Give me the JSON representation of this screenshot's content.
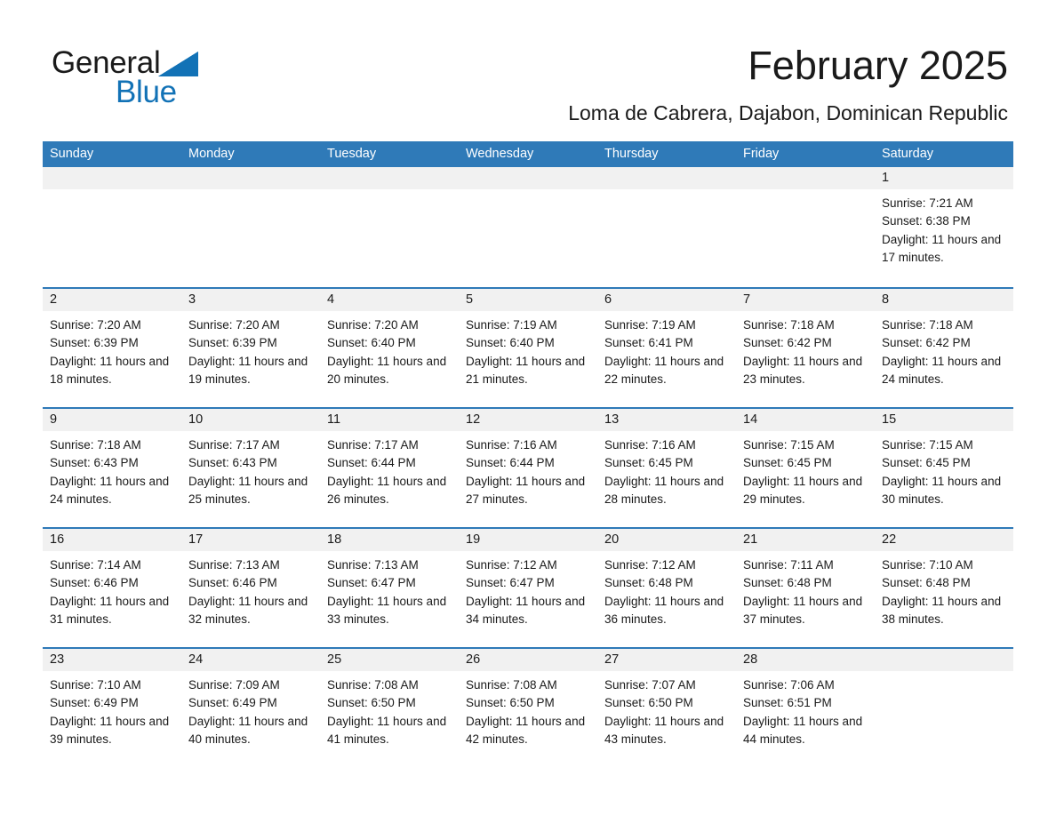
{
  "brand": {
    "word1": "General",
    "word2": "Blue",
    "triangle_color": "#1272b6"
  },
  "header": {
    "month_title": "February 2025",
    "location": "Loma de Cabrera, Dajabon, Dominican Republic",
    "header_bg_color": "#2f7ab8",
    "row_border_color": "#2f7ab8",
    "daynum_band_color": "#f1f1f1"
  },
  "weekdays": [
    "Sunday",
    "Monday",
    "Tuesday",
    "Wednesday",
    "Thursday",
    "Friday",
    "Saturday"
  ],
  "weeks": [
    [
      {
        "empty": true
      },
      {
        "empty": true
      },
      {
        "empty": true
      },
      {
        "empty": true
      },
      {
        "empty": true
      },
      {
        "empty": true
      },
      {
        "day": "1",
        "sunrise": "Sunrise: 7:21 AM",
        "sunset": "Sunset: 6:38 PM",
        "daylight": "Daylight: 11 hours and 17 minutes."
      }
    ],
    [
      {
        "day": "2",
        "sunrise": "Sunrise: 7:20 AM",
        "sunset": "Sunset: 6:39 PM",
        "daylight": "Daylight: 11 hours and 18 minutes."
      },
      {
        "day": "3",
        "sunrise": "Sunrise: 7:20 AM",
        "sunset": "Sunset: 6:39 PM",
        "daylight": "Daylight: 11 hours and 19 minutes."
      },
      {
        "day": "4",
        "sunrise": "Sunrise: 7:20 AM",
        "sunset": "Sunset: 6:40 PM",
        "daylight": "Daylight: 11 hours and 20 minutes."
      },
      {
        "day": "5",
        "sunrise": "Sunrise: 7:19 AM",
        "sunset": "Sunset: 6:40 PM",
        "daylight": "Daylight: 11 hours and 21 minutes."
      },
      {
        "day": "6",
        "sunrise": "Sunrise: 7:19 AM",
        "sunset": "Sunset: 6:41 PM",
        "daylight": "Daylight: 11 hours and 22 minutes."
      },
      {
        "day": "7",
        "sunrise": "Sunrise: 7:18 AM",
        "sunset": "Sunset: 6:42 PM",
        "daylight": "Daylight: 11 hours and 23 minutes."
      },
      {
        "day": "8",
        "sunrise": "Sunrise: 7:18 AM",
        "sunset": "Sunset: 6:42 PM",
        "daylight": "Daylight: 11 hours and 24 minutes."
      }
    ],
    [
      {
        "day": "9",
        "sunrise": "Sunrise: 7:18 AM",
        "sunset": "Sunset: 6:43 PM",
        "daylight": "Daylight: 11 hours and 24 minutes."
      },
      {
        "day": "10",
        "sunrise": "Sunrise: 7:17 AM",
        "sunset": "Sunset: 6:43 PM",
        "daylight": "Daylight: 11 hours and 25 minutes."
      },
      {
        "day": "11",
        "sunrise": "Sunrise: 7:17 AM",
        "sunset": "Sunset: 6:44 PM",
        "daylight": "Daylight: 11 hours and 26 minutes."
      },
      {
        "day": "12",
        "sunrise": "Sunrise: 7:16 AM",
        "sunset": "Sunset: 6:44 PM",
        "daylight": "Daylight: 11 hours and 27 minutes."
      },
      {
        "day": "13",
        "sunrise": "Sunrise: 7:16 AM",
        "sunset": "Sunset: 6:45 PM",
        "daylight": "Daylight: 11 hours and 28 minutes."
      },
      {
        "day": "14",
        "sunrise": "Sunrise: 7:15 AM",
        "sunset": "Sunset: 6:45 PM",
        "daylight": "Daylight: 11 hours and 29 minutes."
      },
      {
        "day": "15",
        "sunrise": "Sunrise: 7:15 AM",
        "sunset": "Sunset: 6:45 PM",
        "daylight": "Daylight: 11 hours and 30 minutes."
      }
    ],
    [
      {
        "day": "16",
        "sunrise": "Sunrise: 7:14 AM",
        "sunset": "Sunset: 6:46 PM",
        "daylight": "Daylight: 11 hours and 31 minutes."
      },
      {
        "day": "17",
        "sunrise": "Sunrise: 7:13 AM",
        "sunset": "Sunset: 6:46 PM",
        "daylight": "Daylight: 11 hours and 32 minutes."
      },
      {
        "day": "18",
        "sunrise": "Sunrise: 7:13 AM",
        "sunset": "Sunset: 6:47 PM",
        "daylight": "Daylight: 11 hours and 33 minutes."
      },
      {
        "day": "19",
        "sunrise": "Sunrise: 7:12 AM",
        "sunset": "Sunset: 6:47 PM",
        "daylight": "Daylight: 11 hours and 34 minutes."
      },
      {
        "day": "20",
        "sunrise": "Sunrise: 7:12 AM",
        "sunset": "Sunset: 6:48 PM",
        "daylight": "Daylight: 11 hours and 36 minutes."
      },
      {
        "day": "21",
        "sunrise": "Sunrise: 7:11 AM",
        "sunset": "Sunset: 6:48 PM",
        "daylight": "Daylight: 11 hours and 37 minutes."
      },
      {
        "day": "22",
        "sunrise": "Sunrise: 7:10 AM",
        "sunset": "Sunset: 6:48 PM",
        "daylight": "Daylight: 11 hours and 38 minutes."
      }
    ],
    [
      {
        "day": "23",
        "sunrise": "Sunrise: 7:10 AM",
        "sunset": "Sunset: 6:49 PM",
        "daylight": "Daylight: 11 hours and 39 minutes."
      },
      {
        "day": "24",
        "sunrise": "Sunrise: 7:09 AM",
        "sunset": "Sunset: 6:49 PM",
        "daylight": "Daylight: 11 hours and 40 minutes."
      },
      {
        "day": "25",
        "sunrise": "Sunrise: 7:08 AM",
        "sunset": "Sunset: 6:50 PM",
        "daylight": "Daylight: 11 hours and 41 minutes."
      },
      {
        "day": "26",
        "sunrise": "Sunrise: 7:08 AM",
        "sunset": "Sunset: 6:50 PM",
        "daylight": "Daylight: 11 hours and 42 minutes."
      },
      {
        "day": "27",
        "sunrise": "Sunrise: 7:07 AM",
        "sunset": "Sunset: 6:50 PM",
        "daylight": "Daylight: 11 hours and 43 minutes."
      },
      {
        "day": "28",
        "sunrise": "Sunrise: 7:06 AM",
        "sunset": "Sunset: 6:51 PM",
        "daylight": "Daylight: 11 hours and 44 minutes."
      },
      {
        "empty": true
      }
    ]
  ]
}
